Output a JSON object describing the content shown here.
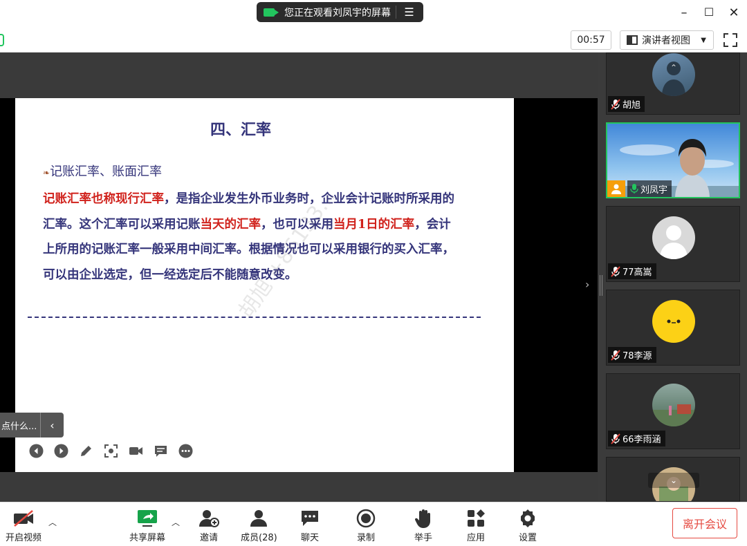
{
  "titlebar": {
    "share_banner_text": "您正在观看刘凤宇的屏幕",
    "share_banner_icon": "camera-icon",
    "menu_icon": "list-menu-icon",
    "minimize": "–",
    "maximize": "☐",
    "close": "✕"
  },
  "toolbar": {
    "timer": "00:57",
    "view_label": "演讲者视图",
    "view_caret": "▼"
  },
  "slide": {
    "title": "四、汇率",
    "subtitle": "记账汇率、账面汇率",
    "bullet": "❧",
    "body": [
      {
        "text": "记账汇率也称现行汇率",
        "red": true
      },
      {
        "text": "，是指企业发生外币业务时，企业会计记账时所采用的汇率。这个汇率可以采用记账",
        "red": false
      },
      {
        "text": "当天的汇率",
        "red": true
      },
      {
        "text": "，也可以采用",
        "red": false
      },
      {
        "text": "当月1日的汇率",
        "red": true
      },
      {
        "text": "，会计上所用的记账汇率一般采用中间汇率。根据情况也可以采用银行的买入汇率，可以由企业选定，但一经选定后不能随意改变。",
        "red": false
      }
    ],
    "watermark": "胡旭 +86133..."
  },
  "floating_tip": {
    "text": "点什么...",
    "arrow": "‹"
  },
  "participants": [
    {
      "name": "胡旭",
      "muted": true,
      "top": 0
    },
    {
      "name": "刘凤宇",
      "muted": false,
      "host": true
    },
    {
      "name": "77高嵩",
      "muted": true
    },
    {
      "name": "78李源",
      "muted": true
    },
    {
      "name": "66李雨涵",
      "muted": true
    },
    {
      "name": "",
      "muted": true
    }
  ],
  "bottom_toolbar": {
    "video": "开启视频",
    "share": "共享屏幕",
    "invite": "邀请",
    "members": "成员(28)",
    "chat": "聊天",
    "record": "录制",
    "raise_hand": "举手",
    "apps": "应用",
    "settings": "设置",
    "leave": "离开会议"
  },
  "colors": {
    "accent_green": "#22c55e",
    "slide_text": "#34347a",
    "slide_red": "#d0211b",
    "leave_red": "#e5483f"
  }
}
